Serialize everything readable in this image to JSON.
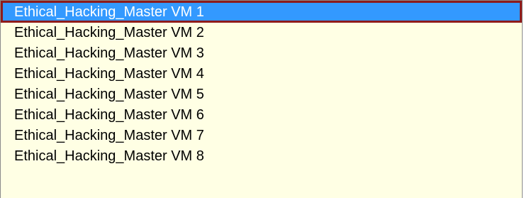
{
  "listbox": {
    "selected_index": 0,
    "items": [
      {
        "label": "Ethical_Hacking_Master VM 1"
      },
      {
        "label": "Ethical_Hacking_Master VM 2"
      },
      {
        "label": "Ethical_Hacking_Master VM 3"
      },
      {
        "label": "Ethical_Hacking_Master VM 4"
      },
      {
        "label": "Ethical_Hacking_Master VM 5"
      },
      {
        "label": "Ethical_Hacking_Master VM 6"
      },
      {
        "label": "Ethical_Hacking_Master VM 7"
      },
      {
        "label": "Ethical_Hacking_Master VM 8"
      }
    ]
  },
  "colors": {
    "list_background": "#ffffe4",
    "selection_background": "#3399ff",
    "selection_border": "#8e1b1b",
    "selection_text": "#ffffff",
    "text": "#000000"
  }
}
